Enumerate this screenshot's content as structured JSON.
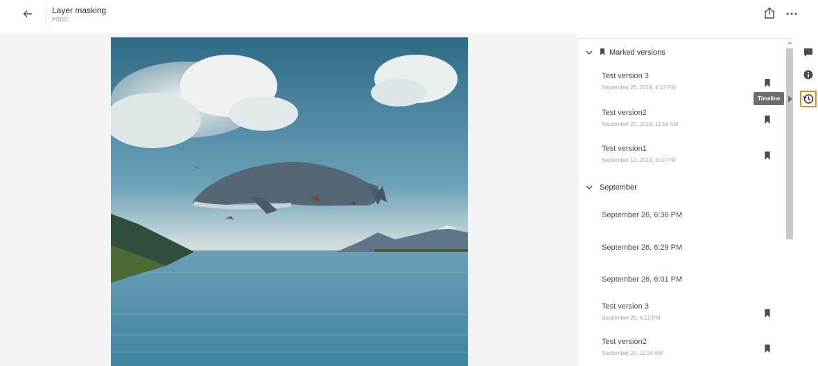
{
  "header": {
    "title": "Layer masking",
    "subtitle": "PSDC",
    "back_icon": "arrow-left-icon",
    "share_icon": "share-icon",
    "more_icon": "more-horizontal-icon"
  },
  "artwork": {
    "description_icon": "artwork-image"
  },
  "versions": {
    "marked_section": {
      "label": "Marked versions",
      "items": [
        {
          "name": "Test version 3",
          "date": "September 26, 2019, 4:12 PM"
        },
        {
          "name": "Test version2",
          "date": "September 20, 2019, 11:54 AM"
        },
        {
          "name": "Test version1",
          "date": "September 12, 2019, 3:10 PM"
        }
      ]
    },
    "month_section": {
      "label": "September",
      "items": [
        {
          "name": "September 26, 6:36 PM",
          "date": ""
        },
        {
          "name": "September 26, 6:29 PM",
          "date": ""
        },
        {
          "name": "September 26, 6:01 PM",
          "date": ""
        },
        {
          "name": "Test version 3",
          "date": "September 26, 4:12 PM"
        },
        {
          "name": "Test version2",
          "date": "September 20, 11:54 AM"
        }
      ]
    }
  },
  "rail": {
    "comments_icon": "comment-icon",
    "info_icon": "info-icon",
    "timeline_icon": "history-clock-icon",
    "tooltip": "Timeline"
  },
  "colors": {
    "accent": "#f0871b",
    "tooltip_bg": "#6e6e6e"
  }
}
